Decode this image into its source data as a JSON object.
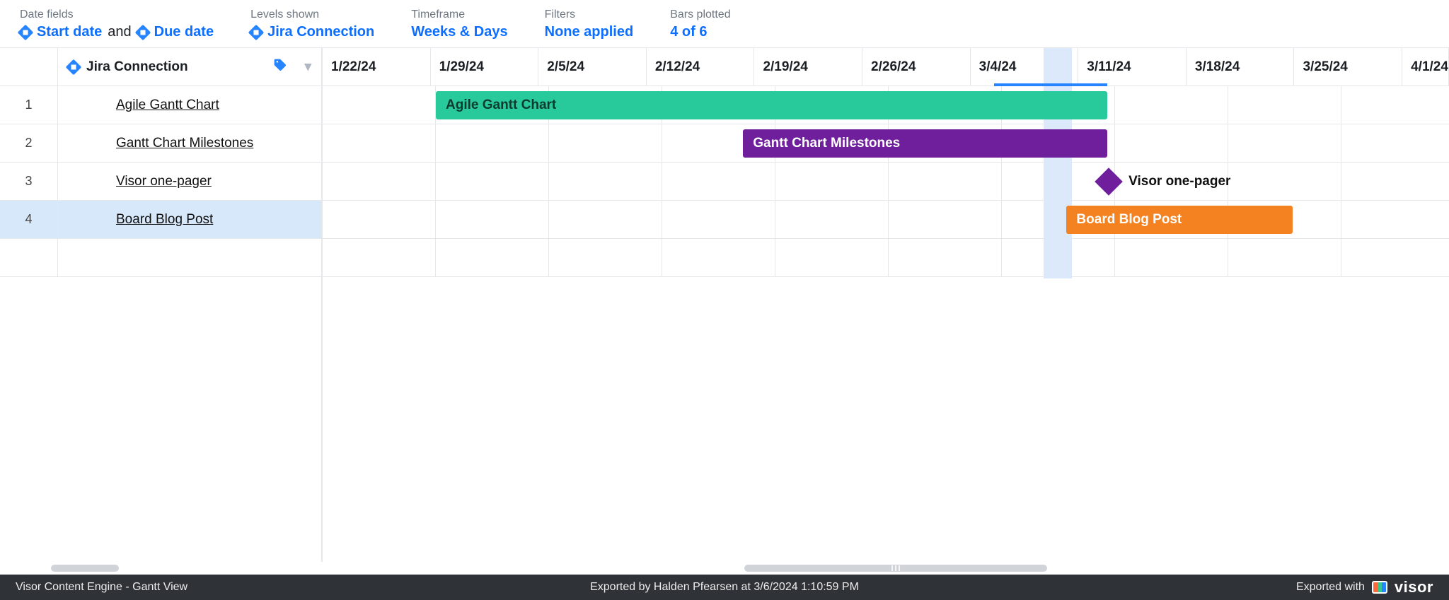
{
  "filterbar": {
    "dateFields": {
      "label": "Date fields",
      "start": "Start date",
      "and": "and",
      "due": "Due date"
    },
    "levels": {
      "label": "Levels shown",
      "value": "Jira Connection"
    },
    "timeframe": {
      "label": "Timeframe",
      "value": "Weeks & Days"
    },
    "filters": {
      "label": "Filters",
      "value": "None applied"
    },
    "bars": {
      "label": "Bars plotted",
      "value": "4 of 6"
    }
  },
  "columnHeader": "Jira Connection",
  "rows": [
    {
      "n": "1",
      "name": "Agile Gantt Chart",
      "selected": false
    },
    {
      "n": "2",
      "name": "Gantt Chart Milestones",
      "selected": false
    },
    {
      "n": "3",
      "name": "Visor one-pager",
      "selected": false
    },
    {
      "n": "4",
      "name": "Board Blog Post",
      "selected": true
    }
  ],
  "timeline": {
    "weeks": [
      "1/22/24",
      "1/29/24",
      "2/5/24",
      "2/12/24",
      "2/19/24",
      "2/26/24",
      "3/4/24",
      "3/11/24",
      "3/18/24",
      "3/25/24",
      "4/1/24"
    ],
    "todayIndex": 6,
    "todayOffsetDays": 3
  },
  "bars": {
    "agile": {
      "label": "Agile Gantt Chart",
      "startDay": 7,
      "endDay": 48.5
    },
    "miles": {
      "label": "Gantt Chart Milestones",
      "startDay": 26,
      "endDay": 48.5
    },
    "onepager": {
      "label": "Visor one-pager",
      "day": 48
    },
    "board": {
      "label": "Board Blog Post",
      "startDay": 46,
      "endDay": 60
    }
  },
  "chart_data": {
    "type": "gantt",
    "unit": "days",
    "origin": "2024-01-22",
    "x_ticks_weeks": [
      "1/22/24",
      "1/29/24",
      "2/5/24",
      "2/12/24",
      "2/19/24",
      "2/26/24",
      "3/4/24",
      "3/11/24",
      "3/18/24",
      "3/25/24",
      "4/1/24"
    ],
    "today": "2024-03-06",
    "tasks": [
      {
        "name": "Agile Gantt Chart",
        "start": "2024-01-29",
        "end": "2024-03-10",
        "color": "#28c99b"
      },
      {
        "name": "Gantt Chart Milestones",
        "start": "2024-02-17",
        "end": "2024-03-10",
        "color": "#6f1f9c"
      },
      {
        "name": "Visor one-pager",
        "milestone": true,
        "date": "2024-03-10",
        "color": "#6f1f9c"
      },
      {
        "name": "Board Blog Post",
        "start": "2024-03-08",
        "end": "2024-03-22",
        "color": "#f58220"
      }
    ],
    "bars_plotted": "4 of 6"
  },
  "footer": {
    "left": "Visor Content Engine - Gantt View",
    "mid": "Exported by Halden Pfearsen at 3/6/2024 1:10:59 PM",
    "rightLabel": "Exported with",
    "brand": "visor"
  }
}
